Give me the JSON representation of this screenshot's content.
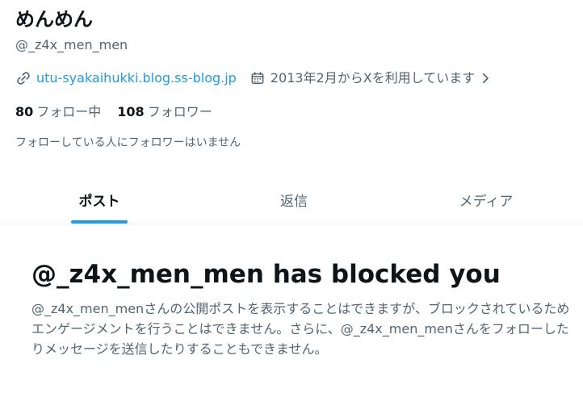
{
  "profile": {
    "name": "めんめん",
    "handle": "@_z4x_men_men",
    "website": "utu-syakaihukki.blog.ss-blog.jp",
    "joined": "2013年2月からXを利用しています",
    "following_count": "80",
    "following_label": "フォロー中",
    "followers_count": "108",
    "followers_label": "フォロワー",
    "followers_note": "フォローしている人にフォロワーはいません"
  },
  "tabs": [
    {
      "label": "ポスト",
      "active": true
    },
    {
      "label": "返信",
      "active": false
    },
    {
      "label": "メディア",
      "active": false
    }
  ],
  "blocked": {
    "title": "@_z4x_men_men has blocked you",
    "description": "@_z4x_men_menさんの公開ポストを表示することはできますが、ブロックされているためエンゲージメントを行うことはできません。さらに、@_z4x_men_menさんをフォローしたりメッセージを送信したりすることもできません。"
  },
  "icons": {
    "link": "link-icon",
    "calendar": "calendar-icon",
    "chevron": "chevron-right-icon"
  },
  "colors": {
    "accent": "#1d9bf0",
    "text_primary": "#0f1419",
    "text_secondary": "#536471",
    "divider": "#eff3f4"
  }
}
